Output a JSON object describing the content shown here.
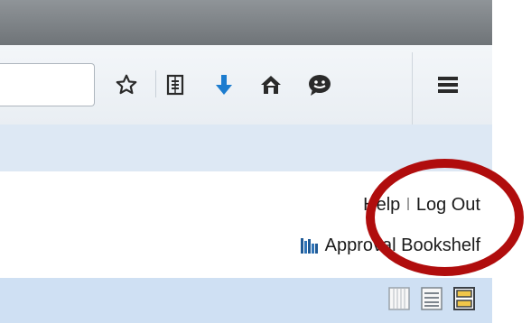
{
  "browser": {
    "toolbar_icons": [
      "star-icon",
      "reading-list-icon",
      "download-icon",
      "home-icon",
      "chat-icon",
      "menu-icon"
    ]
  },
  "header": {
    "help_label": "Help",
    "separator": "I",
    "logout_label": "Log Out",
    "bookshelf_label": "Approval Bookshelf"
  },
  "view_modes": [
    "grid-view-icon",
    "list-view-icon",
    "detail-view-icon"
  ],
  "annotation": {
    "color": "#b00d0d",
    "shape": "ellipse"
  }
}
